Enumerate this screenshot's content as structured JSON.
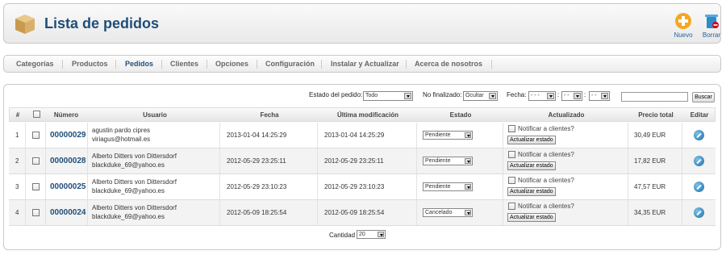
{
  "header": {
    "title": "Lista de pedidos",
    "buttons": [
      {
        "label": "Nuevo",
        "icon": "add-icon",
        "color": "#f5a623"
      },
      {
        "label": "Borrar",
        "icon": "trash-icon",
        "color": "#2e8bc9"
      }
    ]
  },
  "tabs": [
    {
      "label": "Categorías",
      "active": false
    },
    {
      "label": "Productos",
      "active": false
    },
    {
      "label": "Pedidos",
      "active": true
    },
    {
      "label": "Clientes",
      "active": false
    },
    {
      "label": "Opciones",
      "active": false
    },
    {
      "label": "Configuración",
      "active": false
    },
    {
      "label": "Instalar y Actualizar",
      "active": false
    },
    {
      "label": "Acerca de nosotros",
      "active": false
    }
  ],
  "filters": {
    "status_label": "Estado del pedido:",
    "status_value": "Todo",
    "unfinished_label": "No finalizado:",
    "unfinished_value": "Ocultar",
    "date_label": "Fecha:",
    "date_year": "- - -",
    "date_month": "- -",
    "date_day": "- -",
    "date_sep": ":",
    "search_button": "Buscar"
  },
  "table": {
    "columns": [
      "#",
      "",
      "Número",
      "Usuario",
      "Fecha",
      "Última modificación",
      "Estado",
      "Actualizado",
      "Precio total",
      "Editar"
    ],
    "notify_label": "Notificar a clientes?",
    "update_label": "Actualizar estado",
    "rows": [
      {
        "idx": "1",
        "number": "00000029",
        "user_name": "agustin pardo cipres",
        "user_email": "viriagus@hotmail.es",
        "date": "2013-01-04 14:25:29",
        "modified": "2013-01-04 14:25:29",
        "status": "Pendiente",
        "price": "30,49 EUR"
      },
      {
        "idx": "2",
        "number": "00000028",
        "user_name": "Alberto Ditters von Dittersdorf",
        "user_email": "blackduke_69@yahoo.es",
        "date": "2012-05-29 23:25:11",
        "modified": "2012-05-29 23:25:11",
        "status": "Pendiente",
        "price": "17,82 EUR"
      },
      {
        "idx": "3",
        "number": "00000025",
        "user_name": "Alberto Ditters von Dittersdorf",
        "user_email": "blackduke_69@yahoo.es",
        "date": "2012-05-29 23:10:23",
        "modified": "2012-05-29 23:10:23",
        "status": "Pendiente",
        "price": "47,57 EUR"
      },
      {
        "idx": "4",
        "number": "00000024",
        "user_name": "Alberto Ditters von Dittersdorf",
        "user_email": "blackduke_69@yahoo.es",
        "date": "2012-05-09 18:25:54",
        "modified": "2012-05-09 18:25:54",
        "status": "Cancelado",
        "price": "34,35 EUR"
      }
    ]
  },
  "pagination": {
    "quantity_label": "Cantidad",
    "quantity_value": "20"
  }
}
